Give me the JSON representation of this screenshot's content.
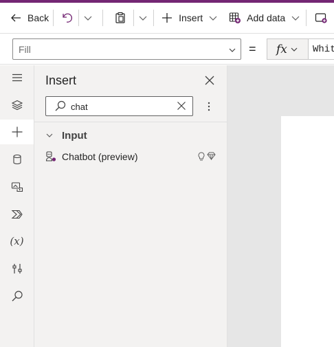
{
  "accent_color": "#742774",
  "command_bar": {
    "back_label": "Back",
    "insert_label": "Insert",
    "add_data_label": "Add data",
    "icons": [
      "back-arrow-icon",
      "undo-icon",
      "chevron-down-icon",
      "paste-icon",
      "chevron-down-icon",
      "plus-icon",
      "chevron-down-icon",
      "add-data-icon",
      "chevron-down-icon",
      "new-screen-icon"
    ]
  },
  "formula_bar": {
    "property_value": "Fill",
    "equals": "=",
    "fx_label": "fx",
    "formula_text": "Whit"
  },
  "left_rail": {
    "icons": [
      "hamburger-menu-icon",
      "tree-view-icon",
      "insert-plus-icon",
      "data-cylinder-icon",
      "media-icon",
      "power-automate-icon",
      "variables-icon",
      "advanced-tools-icon",
      "search-icon"
    ],
    "variables_label": "(x)",
    "active_item": "insert-plus-icon"
  },
  "insert_panel": {
    "title": "Insert",
    "search_value": "chat",
    "group_label": "Input",
    "items": [
      {
        "label": "Chatbot (preview)",
        "icon": "chatbot-icon",
        "badges": [
          "lightbulb-icon",
          "premium-diamond-icon"
        ]
      }
    ]
  }
}
